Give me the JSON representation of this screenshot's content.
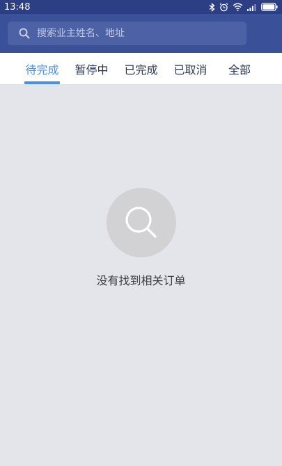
{
  "status_bar": {
    "time": "13:48",
    "icons": [
      "bluetooth-icon",
      "alarm-icon",
      "wifi-icon",
      "signal-icon",
      "battery-icon"
    ]
  },
  "search": {
    "placeholder": "搜索业主姓名、地址",
    "value": ""
  },
  "tabs": [
    {
      "label": "待完成",
      "active": true
    },
    {
      "label": "暂停中",
      "active": false
    },
    {
      "label": "已完成",
      "active": false
    },
    {
      "label": "已取消",
      "active": false
    },
    {
      "label": "全部",
      "active": false
    }
  ],
  "empty_state": {
    "icon": "search-icon",
    "message": "没有找到相关订单"
  },
  "colors": {
    "status_bar": "#2c3f85",
    "header": "#3a5199",
    "search_box": "#4d62a5",
    "accent": "#4a90e2",
    "background": "#e4e5ea"
  }
}
